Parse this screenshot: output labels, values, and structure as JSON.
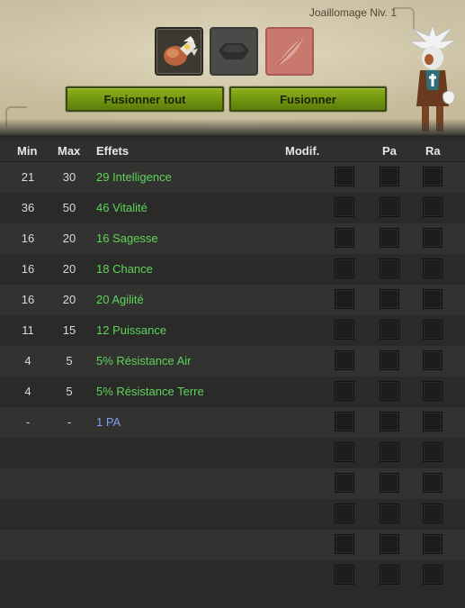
{
  "header": {
    "job_title": "Joaillomage Niv. 1",
    "slots": [
      {
        "name": "item",
        "icon": "amulet-item-icon"
      },
      {
        "name": "rune",
        "icon": "rune-icon"
      },
      {
        "name": "potion",
        "icon": "feather-potion-icon"
      }
    ],
    "buttons": {
      "fuse_all": "Fusionner tout",
      "fuse": "Fusionner"
    },
    "character_icon": "white-haired-character-avatar"
  },
  "table": {
    "headers": {
      "min": "Min",
      "max": "Max",
      "effects": "Effets",
      "modif": "Modif.",
      "pa": "Pa",
      "ra": "Ra"
    },
    "rows": [
      {
        "min": "21",
        "max": "30",
        "effect": "29 Intelligence",
        "color": "#5fd35a"
      },
      {
        "min": "36",
        "max": "50",
        "effect": "46 Vitalité",
        "color": "#5fd35a"
      },
      {
        "min": "16",
        "max": "20",
        "effect": "16 Sagesse",
        "color": "#5fd35a"
      },
      {
        "min": "16",
        "max": "20",
        "effect": "18 Chance",
        "color": "#5fd35a"
      },
      {
        "min": "16",
        "max": "20",
        "effect": "20 Agilité",
        "color": "#5fd35a"
      },
      {
        "min": "11",
        "max": "15",
        "effect": "12 Puissance",
        "color": "#5fd35a"
      },
      {
        "min": "4",
        "max": "5",
        "effect": "5% Résistance Air",
        "color": "#5fd35a"
      },
      {
        "min": "4",
        "max": "5",
        "effect": "5% Résistance Terre",
        "color": "#5fd35a"
      },
      {
        "min": "-",
        "max": "-",
        "effect": "1 PA",
        "color": "#7f9ff0"
      },
      {
        "min": "",
        "max": "",
        "effect": "",
        "color": "#5fd35a"
      },
      {
        "min": "",
        "max": "",
        "effect": "",
        "color": "#5fd35a"
      },
      {
        "min": "",
        "max": "",
        "effect": "",
        "color": "#5fd35a"
      },
      {
        "min": "",
        "max": "",
        "effect": "",
        "color": "#5fd35a"
      },
      {
        "min": "",
        "max": "",
        "effect": "",
        "color": "#5fd35a"
      }
    ]
  },
  "colors": {
    "button_green": "#7a9c14",
    "effect_green": "#5fd35a",
    "effect_blue": "#7f9ff0",
    "parchment": "#cfc5a8"
  }
}
